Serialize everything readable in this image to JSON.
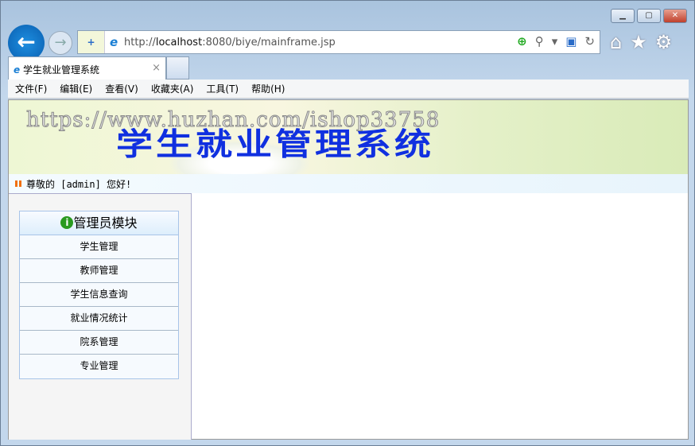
{
  "window": {
    "minimize": "▁",
    "maximize": "▢",
    "close": "✕"
  },
  "address": {
    "url_prefix": "http://",
    "url_host": "localhost",
    "url_rest": ":8080/biye/mainframe.jsp"
  },
  "tab": {
    "title": "学生就业管理系统",
    "close": "×"
  },
  "menu": [
    "文件(F)",
    "编辑(E)",
    "查看(V)",
    "收藏夹(A)",
    "工具(T)",
    "帮助(H)"
  ],
  "banner": {
    "title": "学生就业管理系统",
    "watermark": "https://www.huzhan.com/ishop33758"
  },
  "greeting": "尊敬的 [admin] 您好!",
  "sidebar": {
    "header": "管理员模块",
    "items": [
      "学生管理",
      "教师管理",
      "学生信息查询",
      "就业情况统计",
      "院系管理",
      "专业管理"
    ]
  }
}
